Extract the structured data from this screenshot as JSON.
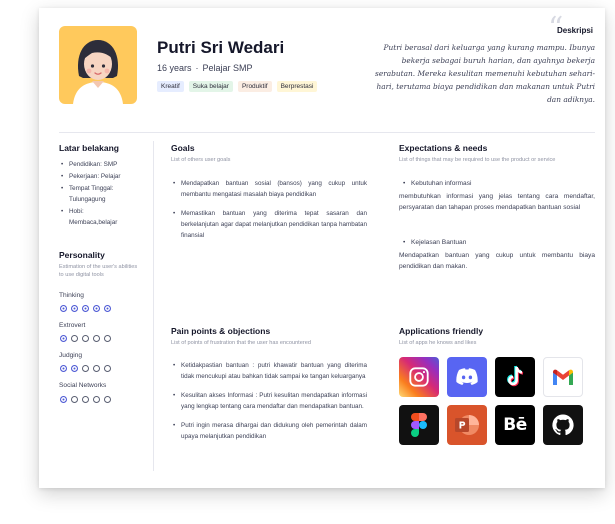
{
  "profile": {
    "name": "Putri Sri Wedari",
    "age": "16 years",
    "role": "Pelajar SMP",
    "tags": [
      {
        "label": "Kreatif",
        "color": "#E6EDFF"
      },
      {
        "label": "Suka belajar",
        "color": "#E3F5E8"
      },
      {
        "label": "Produktif",
        "color": "#FBEDE3"
      },
      {
        "label": "Berprestasi",
        "color": "#FFF6D6"
      }
    ]
  },
  "description": {
    "title": "Deskripsi",
    "text": "Putri berasal dari keluarga yang kurang mampu. Ibunya bekerja sebagai buruh harian, dan ayahnya bekerja serabutan. Mereka kesulitan memenuhi kebutuhan sehari-hari, terutama biaya pendidikan dan makanan untuk Putri dan adiknya."
  },
  "background": {
    "title": "Latar belakang",
    "items": [
      {
        "l1": "Pendidikan:  SMP",
        "l2": ""
      },
      {
        "l1": "Pekerjaan: Pelajar",
        "l2": ""
      },
      {
        "l1": "Tempat Tinggal:",
        "l2": "Tulungagung"
      },
      {
        "l1": "Hobi:",
        "l2": "Membaca,belajar"
      }
    ]
  },
  "personality": {
    "title": "Personality",
    "subtitle": "Estimation of the user's abilities to use digital tools",
    "traits": [
      {
        "label": "Thinking",
        "level": 5
      },
      {
        "label": "Extrovert",
        "level": 1
      },
      {
        "label": "Judging",
        "level": 2
      },
      {
        "label": "Social Networks",
        "level": 1
      }
    ]
  },
  "goals": {
    "title": "Goals",
    "subtitle": "List of others user goals",
    "items": [
      "Mendapatkan bantuan sosial (bansos) yang cukup untuk membantu mengatasi masalah biaya pendidikan",
      "Memastikan bantuan yang diterima tepat sasaran dan berkelanjutan agar dapat melanjutkan pendidikan tanpa hambatan finansial"
    ]
  },
  "expectations": {
    "title": "Expectations & needs",
    "subtitle": "List of things that may be required to use the product or service",
    "items": [
      {
        "head": "Kebutuhan informasi",
        "text": "membutuhkan informasi yang jelas tentang cara mendaftar, persyaratan dan tahapan proses mendapatkan bantuan sosial"
      },
      {
        "head": "Kejelasan Bantuan",
        "text": "Mendapatkan bantuan yang cukup untuk membantu biaya pendidikan dan makan."
      }
    ]
  },
  "pain_points": {
    "title": "Pain points & objections",
    "subtitle": "List of points of frustration that the user has encountered",
    "items": [
      "Ketidakpastian bantuan : putri khawatir bantuan yang diterima tidak mencukupi atau bahkan tidak sampai ke tangan keluarganya",
      "Kesulitan akses Informasi : Putri kesulitan mendapatkan informasi yang lengkap tentang cara mendaftar dan mendapatkan bantuan.",
      "Putri ingin merasa dihargai dan didukung oleh pemerintah dalam upaya melanjutkan pendidikan"
    ]
  },
  "applications": {
    "title": "Applications friendly",
    "subtitle": "List of apps he knows and likes",
    "apps": [
      {
        "icon": "instagram-icon",
        "bg": "#C13584"
      },
      {
        "icon": "discord-icon",
        "bg": "#5865F2"
      },
      {
        "icon": "tiktok-icon",
        "bg": "#000000"
      },
      {
        "icon": "gmail-icon",
        "bg": "#FFFFFF"
      },
      {
        "icon": "figma-icon",
        "bg": "#111111"
      },
      {
        "icon": "powerpoint-icon",
        "bg": "#D24726"
      },
      {
        "icon": "behance-icon",
        "bg": "#000000"
      },
      {
        "icon": "github-icon",
        "bg": "#111111"
      }
    ],
    "behance_text": "Bē"
  }
}
